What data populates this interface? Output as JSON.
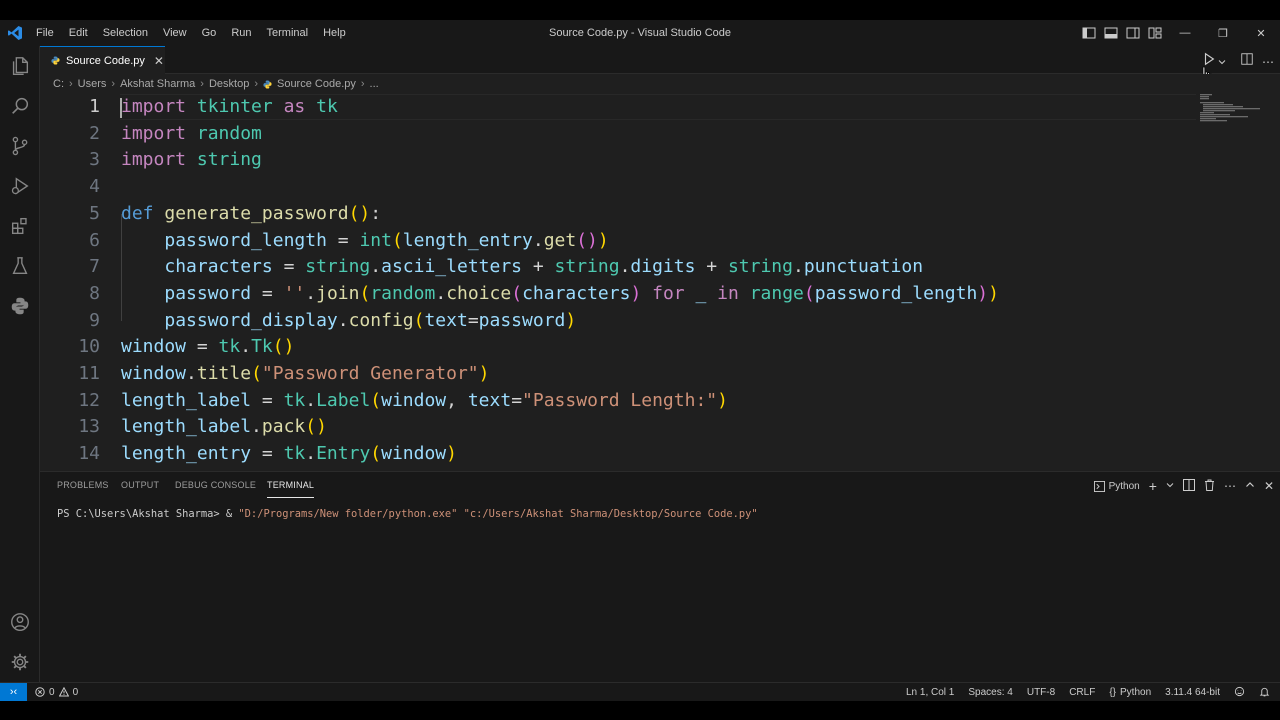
{
  "window": {
    "title": "Source Code.py - Visual Studio Code",
    "menu": [
      "File",
      "Edit",
      "Selection",
      "View",
      "Go",
      "Run",
      "Terminal",
      "Help"
    ],
    "controls": {
      "minimize": "—",
      "maximize": "❐",
      "close": "✕"
    }
  },
  "tab": {
    "label": "Source Code.py",
    "close": "✕"
  },
  "breadcrumb": [
    "C:",
    "Users",
    "Akshat Sharma",
    "Desktop",
    "Source Code.py",
    "..."
  ],
  "breadcrumb_sep": "›",
  "editor": {
    "line_numbers": [
      "1",
      "2",
      "3",
      "4",
      "5",
      "6",
      "7",
      "8",
      "9",
      "10",
      "11",
      "12",
      "13",
      "14"
    ],
    "active_line": 1
  },
  "panel": {
    "tabs": [
      "PROBLEMS",
      "OUTPUT",
      "DEBUG CONSOLE",
      "TERMINAL"
    ],
    "active_tab": "TERMINAL",
    "terminal_profile": "Python",
    "terminal": {
      "prompt": "PS C:\\Users\\Akshat Sharma> & ",
      "exe": "\"D:/Programs/New folder/python.exe\"",
      "space": " ",
      "script": "\"c:/Users/Akshat Sharma/Desktop/Source Code.py\""
    }
  },
  "status": {
    "errors": "0",
    "warnings": "0",
    "position": "Ln 1, Col 1",
    "spaces": "Spaces: 4",
    "encoding": "UTF-8",
    "eol": "CRLF",
    "language": "Python",
    "interpreter": "3.11.4 64-bit"
  },
  "colors": {
    "accent": "#0078d4",
    "keyword": "#c586c0",
    "module": "#4ec9b0",
    "function": "#dcdcaa",
    "variable": "#9cdcfe",
    "string": "#ce9178",
    "def": "#569cd6"
  },
  "icons": [
    "vscode-logo-icon",
    "explorer-icon",
    "search-icon",
    "source-control-icon",
    "run-debug-icon",
    "extensions-icon",
    "testing-icon",
    "python-icon",
    "accounts-icon",
    "manage-gear-icon",
    "run-file-icon",
    "split-editor-icon",
    "more-actions-icon",
    "remote-icon",
    "error-icon",
    "warning-icon",
    "bell-icon"
  ],
  "code": [
    [
      [
        "kw",
        "import"
      ],
      [
        "op",
        " "
      ],
      [
        "mod",
        "tkinter"
      ],
      [
        "op",
        " "
      ],
      [
        "kw",
        "as"
      ],
      [
        "op",
        " "
      ],
      [
        "mod",
        "tk"
      ]
    ],
    [
      [
        "kw",
        "import"
      ],
      [
        "op",
        " "
      ],
      [
        "mod",
        "random"
      ]
    ],
    [
      [
        "kw",
        "import"
      ],
      [
        "op",
        " "
      ],
      [
        "mod",
        "string"
      ]
    ],
    [],
    [
      [
        "def",
        "def"
      ],
      [
        "op",
        " "
      ],
      [
        "fn",
        "generate_password"
      ],
      [
        "p1",
        "()"
      ],
      [
        "op",
        ":"
      ]
    ],
    [
      [
        "op",
        "    "
      ],
      [
        "var",
        "password_length"
      ],
      [
        "op",
        " = "
      ],
      [
        "cls",
        "int"
      ],
      [
        "p1",
        "("
      ],
      [
        "var",
        "length_entry"
      ],
      [
        "op",
        "."
      ],
      [
        "fn",
        "get"
      ],
      [
        "p2",
        "()"
      ],
      [
        "p1",
        ")"
      ]
    ],
    [
      [
        "op",
        "    "
      ],
      [
        "var",
        "characters"
      ],
      [
        "op",
        " = "
      ],
      [
        "mod",
        "string"
      ],
      [
        "op",
        "."
      ],
      [
        "var",
        "ascii_letters"
      ],
      [
        "op",
        " + "
      ],
      [
        "mod",
        "string"
      ],
      [
        "op",
        "."
      ],
      [
        "var",
        "digits"
      ],
      [
        "op",
        " + "
      ],
      [
        "mod",
        "string"
      ],
      [
        "op",
        "."
      ],
      [
        "var",
        "punctuation"
      ]
    ],
    [
      [
        "op",
        "    "
      ],
      [
        "var",
        "password"
      ],
      [
        "op",
        " = "
      ],
      [
        "str",
        "''"
      ],
      [
        "op",
        "."
      ],
      [
        "fn",
        "join"
      ],
      [
        "p1",
        "("
      ],
      [
        "mod",
        "random"
      ],
      [
        "op",
        "."
      ],
      [
        "fn",
        "choice"
      ],
      [
        "p2",
        "("
      ],
      [
        "var",
        "characters"
      ],
      [
        "p2",
        ")"
      ],
      [
        "op",
        " "
      ],
      [
        "kw",
        "for"
      ],
      [
        "op",
        " "
      ],
      [
        "var",
        "_"
      ],
      [
        "op",
        " "
      ],
      [
        "kw",
        "in"
      ],
      [
        "op",
        " "
      ],
      [
        "cls",
        "range"
      ],
      [
        "p2",
        "("
      ],
      [
        "var",
        "password_length"
      ],
      [
        "p2",
        ")"
      ],
      [
        "p1",
        ")"
      ]
    ],
    [
      [
        "op",
        "    "
      ],
      [
        "var",
        "password_display"
      ],
      [
        "op",
        "."
      ],
      [
        "fn",
        "config"
      ],
      [
        "p1",
        "("
      ],
      [
        "var",
        "text"
      ],
      [
        "op",
        "="
      ],
      [
        "var",
        "password"
      ],
      [
        "p1",
        ")"
      ]
    ],
    [
      [
        "var",
        "window"
      ],
      [
        "op",
        " = "
      ],
      [
        "mod",
        "tk"
      ],
      [
        "op",
        "."
      ],
      [
        "cls",
        "Tk"
      ],
      [
        "p1",
        "()"
      ]
    ],
    [
      [
        "var",
        "window"
      ],
      [
        "op",
        "."
      ],
      [
        "fn",
        "title"
      ],
      [
        "p1",
        "("
      ],
      [
        "str",
        "\"Password Generator\""
      ],
      [
        "p1",
        ")"
      ]
    ],
    [
      [
        "var",
        "length_label"
      ],
      [
        "op",
        " = "
      ],
      [
        "mod",
        "tk"
      ],
      [
        "op",
        "."
      ],
      [
        "cls",
        "Label"
      ],
      [
        "p1",
        "("
      ],
      [
        "var",
        "window"
      ],
      [
        "op",
        ", "
      ],
      [
        "var",
        "text"
      ],
      [
        "op",
        "="
      ],
      [
        "str",
        "\"Password Length:\""
      ],
      [
        "p1",
        ")"
      ]
    ],
    [
      [
        "var",
        "length_label"
      ],
      [
        "op",
        "."
      ],
      [
        "fn",
        "pack"
      ],
      [
        "p1",
        "()"
      ]
    ],
    [
      [
        "var",
        "length_entry"
      ],
      [
        "op",
        " = "
      ],
      [
        "mod",
        "tk"
      ],
      [
        "op",
        "."
      ],
      [
        "cls",
        "Entry"
      ],
      [
        "p1",
        "("
      ],
      [
        "var",
        "window"
      ],
      [
        "p1",
        ")"
      ]
    ]
  ]
}
